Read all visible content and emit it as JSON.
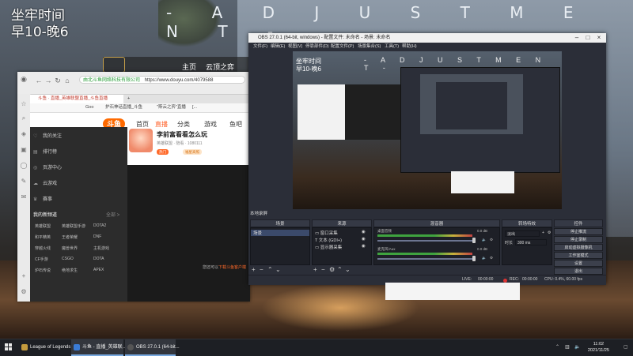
{
  "overlay": {
    "schedule_line1": "坐牢时间",
    "schedule_line2": "早10-晚6",
    "title": "- A D J U S T M E N T -"
  },
  "bg_site": {
    "nav1": "主页",
    "nav2": "云顶之弈"
  },
  "browser": {
    "url_secure": "由北斗鱼网络科技有限公司",
    "url": "https://www.douyu.com/4079588",
    "tab_active": "斗鱼 · 直播_英雄联盟直播_斗鱼直播",
    "bookmarks": [
      "Goo",
      "护石神话直播_斗鱼",
      "\"斯云之弈\"直播",
      "[..."
    ],
    "site": {
      "logo": "斗鱼",
      "nav": [
        "首页",
        "直播",
        "分类",
        "游戏",
        "鱼吧"
      ],
      "nav_active_index": 1,
      "left_menu": [
        "我的关注",
        "排行榜",
        "页游中心",
        "云游戏",
        "赛事"
      ],
      "left_games_header": "我的新频道",
      "left_games_more": "全部 >",
      "games": [
        "英雄联盟",
        "和平精英",
        "穿越火线",
        "CF手游",
        "炉石传说",
        "英雄联盟手游",
        "王者荣耀",
        "魔兽世界",
        "DOTA2",
        "DNF",
        "CSGO",
        "绝地求生",
        "主机游戏",
        "DOTA",
        "APEX"
      ],
      "room_title": "李前富看看怎么玩",
      "room_meta": "英雄联盟 · 陪看 · 1080111",
      "room_tags": [
        "热门",
        "福星高照"
      ],
      "bottom_link_prefix": "您还可以",
      "bottom_link": "下载斗鱼客户端"
    }
  },
  "obs": {
    "title": "OBS 27.0.1 (64-bit, windows) - 配置文件: 未命名 - 场景: 未命名",
    "menus": [
      "文件(F)",
      "编辑(E)",
      "视图(V)",
      "停靠部件(D)",
      "配置文件(P)",
      "场景集合(S)",
      "工具(T)",
      "帮助(H)"
    ],
    "preview_caption": "本地录屏",
    "panels": {
      "scenes": "场景",
      "sources": "来源",
      "mixer": "混音器",
      "transitions": "转场特效",
      "controls": "控件"
    },
    "scene_items": [
      "场景"
    ],
    "source_items": [
      "窗口采集",
      "文本 (GDI+)",
      "显示器采集"
    ],
    "mixer": [
      {
        "name": "桌面音频",
        "db": "0.0 dB"
      },
      {
        "name": "麦克风/Aux",
        "db": "0.0 dB"
      }
    ],
    "transition_value": "淡出",
    "transition_label": "时长",
    "transition_duration": "300 ms",
    "control_buttons": [
      "停止推流",
      "停止录制",
      "启动虚拟摄像机",
      "工作室模式",
      "设置",
      "退出"
    ],
    "status": {
      "live_label": "LIVE:",
      "live_time": "00:00:00",
      "rec_label": "REC:",
      "rec_time": "00:00:00",
      "cpu": "CPU: 0.4%, 60.00 fps"
    }
  },
  "taskbar": {
    "items": [
      "League of Legends",
      "斗鱼 - 直播_英雄联..",
      "OBS 27.0.1 (64-bit..."
    ],
    "time": "11:02",
    "date": "2021/11/25"
  }
}
